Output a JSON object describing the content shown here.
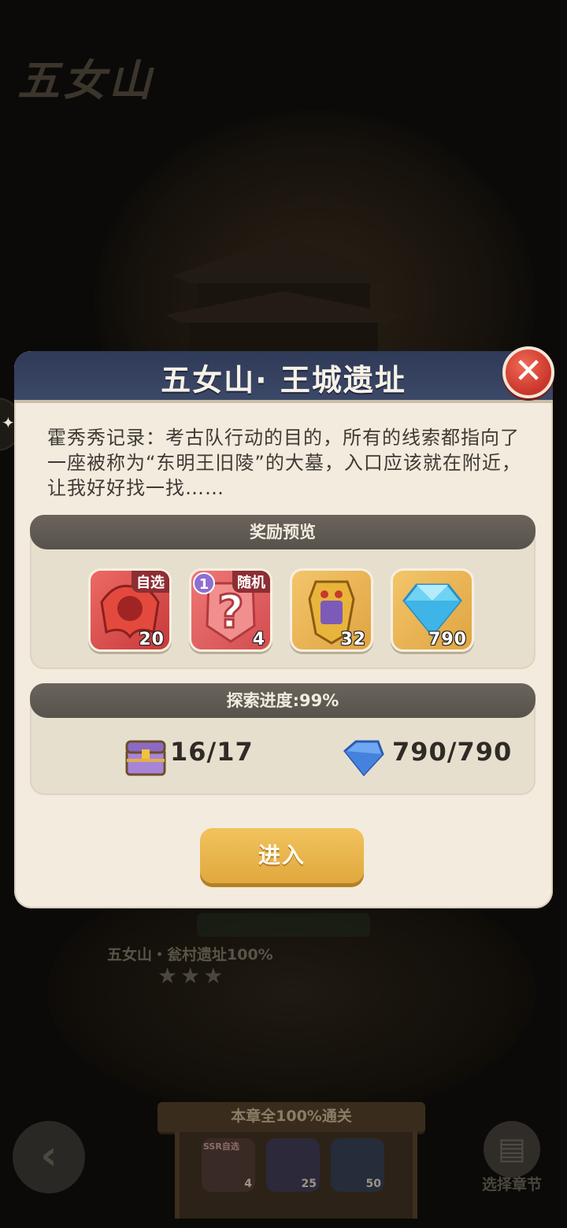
{
  "scene": {
    "title": "五女山",
    "stage_label": "五女山・瓮村遗址100%",
    "stars": [
      "★",
      "★",
      "★"
    ]
  },
  "chapter_board": {
    "title": "本章全100%通关",
    "items": [
      {
        "tag": "SSR自选",
        "count": "4",
        "icon": "ssr-emblem-icon"
      },
      {
        "tag": "",
        "count": "25",
        "icon": "shovel-icon"
      },
      {
        "tag": "",
        "count": "50",
        "icon": "hourglass-icon"
      }
    ]
  },
  "nav": {
    "back_glyph": "‹",
    "chapter_select_label": "选择章节",
    "chapter_icon": "▤"
  },
  "dialog": {
    "title": "五女山· 王城遗址",
    "close_glyph": "✕",
    "description": "霍秀秀记录：考古队行动的目的，所有的线索都指向了一座被称为“东明王旧陵”的大墓，入口应该就在附近，让我好好找一找……",
    "rewards_header": "奖励预览",
    "rewards": [
      {
        "icon": "red-cloak-icon",
        "tag": "自选",
        "badge": "",
        "count": "20"
      },
      {
        "icon": "random-question-icon",
        "tag": "随机",
        "badge": "1",
        "count": "4"
      },
      {
        "icon": "golden-mask-icon",
        "tag": "",
        "badge": "",
        "count": "32"
      },
      {
        "icon": "diamond-icon",
        "tag": "",
        "badge": "",
        "count": "790"
      }
    ],
    "progress_header": "探索进度:99%",
    "chests_value": "16/17",
    "diamonds_value": "790/790",
    "enter_label": "进入"
  },
  "colors": {
    "header_navy": "#35405f",
    "close_red": "#d94436",
    "enter_gold": "#e8b64e",
    "dialog_bg": "#f2ebde"
  }
}
